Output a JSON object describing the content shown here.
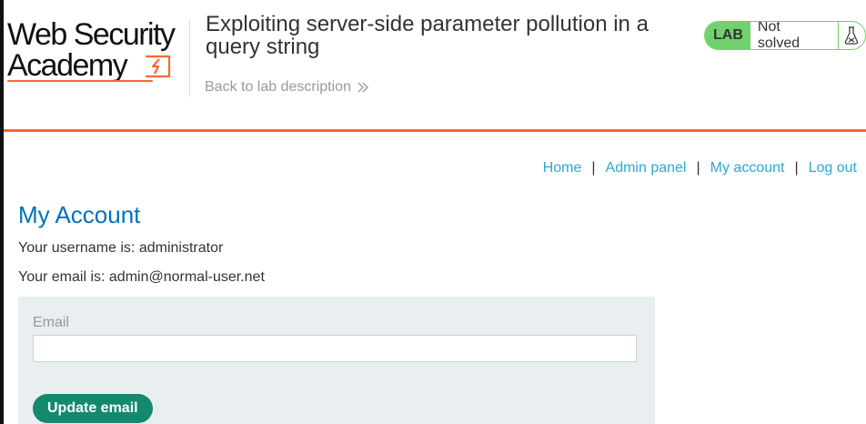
{
  "header": {
    "logo": {
      "line1": "Web Security",
      "line2": "Academy"
    },
    "lab_title": "Exploiting server-side parameter pollution in a query string",
    "back_link": "Back to lab description",
    "status": {
      "badge": "LAB",
      "text": "Not solved"
    }
  },
  "nav": {
    "home": "Home",
    "admin_panel": "Admin panel",
    "my_account": "My account",
    "log_out": "Log out",
    "separator": "|"
  },
  "content": {
    "title": "My Account",
    "username_line": "Your username is: administrator",
    "email_line": "Your email is: admin@normal-user.net",
    "form": {
      "email_label": "Email",
      "email_value": "",
      "submit_label": "Update email"
    }
  },
  "colors": {
    "accent_orange": "#ff6633",
    "link_blue": "#2ba8d6",
    "title_blue": "#0071bc",
    "status_green": "#70d16d",
    "button_green": "#138a6e"
  }
}
